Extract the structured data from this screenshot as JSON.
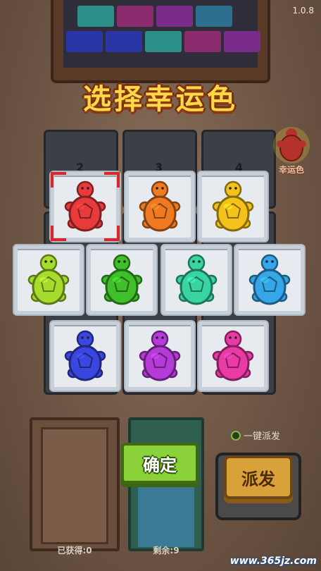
{
  "version": "1.0.8",
  "title": "选择幸运色",
  "lucky": {
    "label": "幸运色",
    "color": "#c0392b"
  },
  "slot_numbers": [
    "2",
    "3",
    "4"
  ],
  "turtles": [
    {
      "name": "red",
      "color": "#e83a3a",
      "selected": true
    },
    {
      "name": "orange",
      "color": "#f07a22",
      "selected": false
    },
    {
      "name": "yellow",
      "color": "#f4c21a",
      "selected": false
    },
    {
      "name": "lime",
      "color": "#a6dc2c",
      "selected": false
    },
    {
      "name": "green",
      "color": "#3fbf2a",
      "selected": false
    },
    {
      "name": "teal",
      "color": "#38d4a2",
      "selected": false
    },
    {
      "name": "sky",
      "color": "#35a6e8",
      "selected": false
    },
    {
      "name": "blue",
      "color": "#3a46e0",
      "selected": false
    },
    {
      "name": "purple",
      "color": "#b53ad8",
      "selected": false
    },
    {
      "name": "pink",
      "color": "#ea3aa6",
      "selected": false
    }
  ],
  "confirm_label": "确定",
  "dispatch_label": "派发",
  "auto_dispatch_label": "一键派发",
  "obtained_label": "已获得:0",
  "remaining_label": "剩余:9",
  "watermark": "www.365jz.com"
}
